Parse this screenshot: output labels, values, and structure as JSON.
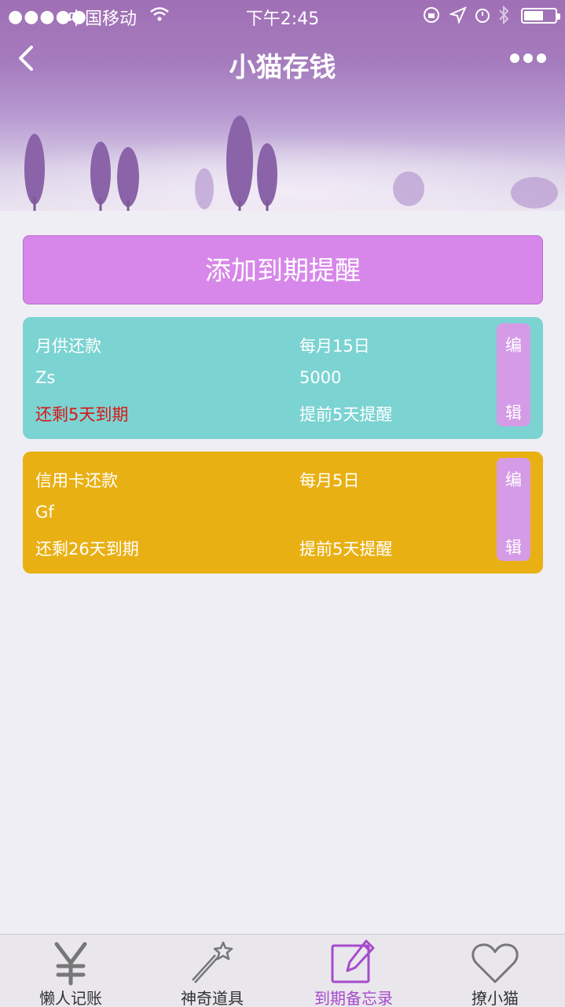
{
  "status_bar": {
    "signal": "●●●●●",
    "carrier": "中国移动",
    "time": "下午2:45"
  },
  "nav": {
    "title": "小猫存钱"
  },
  "main": {
    "add_button": "添加到期提醒",
    "edit_top": "编",
    "edit_bottom": "辑",
    "reminders": [
      {
        "name": "月供还款",
        "due": "每月15日",
        "note": "Zs",
        "amount": "5000",
        "remaining": "还剩5天到期",
        "remind": "提前5天提醒",
        "color": "#7bd3d2",
        "remaining_color": "#d91515"
      },
      {
        "name": "信用卡还款",
        "due": "每月5日",
        "note": "Gf",
        "amount": "",
        "remaining": "还剩26天到期",
        "remind": "提前5天提醒",
        "color": "#e9b014",
        "remaining_color": "#ffffff"
      }
    ]
  },
  "tabbar": {
    "tabs": [
      {
        "label": "懒人记账",
        "icon": "yen-icon"
      },
      {
        "label": "神奇道具",
        "icon": "magic-wand-icon"
      },
      {
        "label": "到期备忘录",
        "icon": "edit-memo-icon",
        "active": true
      },
      {
        "label": "撩小猫",
        "icon": "heart-icon"
      }
    ],
    "active_color": "#a64bcc"
  }
}
